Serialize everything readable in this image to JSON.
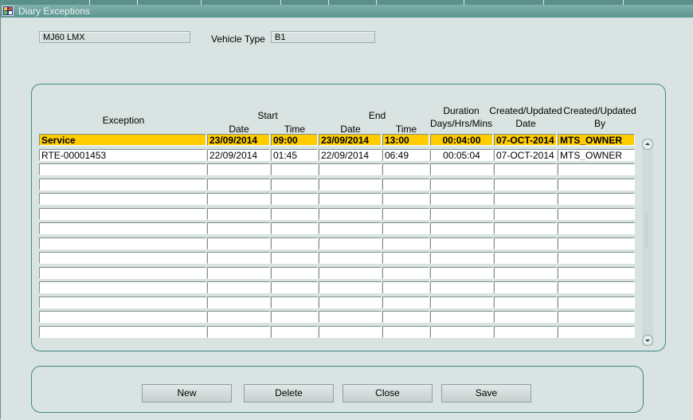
{
  "window": {
    "title": "Diary Exceptions"
  },
  "registration": {
    "value": "MJ60 LMX"
  },
  "vehicle_type": {
    "label": "Vehicle Type",
    "value": "B1"
  },
  "table": {
    "headers": {
      "exception": "Exception",
      "start": "Start",
      "start_date": "Date",
      "start_time": "Time",
      "end": "End",
      "end_date": "Date",
      "end_time": "Time",
      "duration_1": "Duration",
      "duration_2": "Days/Hrs/Mins",
      "created_1": "Created/Updated",
      "created_2": "Date",
      "createdby_1": "Created/Updated",
      "createdby_2": "By"
    },
    "rows": [
      {
        "exception": "Service",
        "start_date": "23/09/2014",
        "start_time": "09:00",
        "end_date": "23/09/2014",
        "end_time": "13:00",
        "duration": "00:04:00",
        "created_date": "07-OCT-2014",
        "created_by": "MTS_OWNER"
      },
      {
        "exception": "RTE-00001453",
        "start_date": "22/09/2014",
        "start_time": "01:45",
        "end_date": "22/09/2014",
        "end_time": "06:49",
        "duration": "00:05:04",
        "created_date": "07-OCT-2014",
        "created_by": "MTS_OWNER"
      }
    ],
    "selected_row": 0,
    "total_rows": 14
  },
  "buttons": {
    "new": "New",
    "delete": "Delete",
    "close": "Close",
    "save": "Save"
  },
  "colors": {
    "selected_row": "#ffcc00",
    "panel_border": "#3f8b84",
    "title_bar": "#6fa19c"
  }
}
